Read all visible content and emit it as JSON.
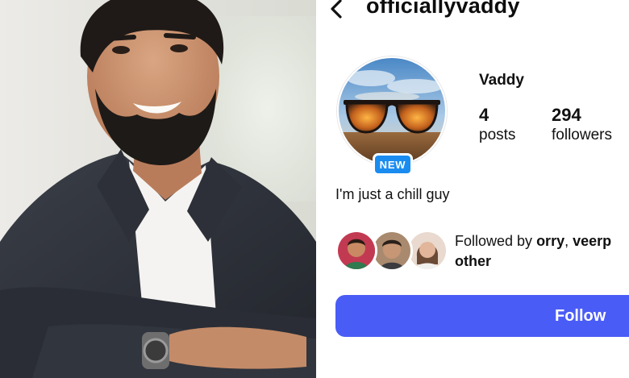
{
  "profile": {
    "username": "officiallyvaddy",
    "display_name": "Vaddy",
    "avatar_badge": "NEW",
    "stats": {
      "posts_count": "4",
      "posts_label": "posts",
      "followers_count": "294",
      "followers_label": "followers"
    },
    "bio": "I'm just a chill guy",
    "followed_by": {
      "prefix": "Followed by ",
      "user1": "orry",
      "separator": ", ",
      "user2": "veerp",
      "line2": "other"
    },
    "follow_button_label": "Follow"
  },
  "icons": {
    "back": "chevron-left-icon"
  },
  "colors": {
    "follow_button": "#4a5cf6",
    "new_badge": "#1a8cf0",
    "background": "#ffffff",
    "text": "#111111"
  }
}
